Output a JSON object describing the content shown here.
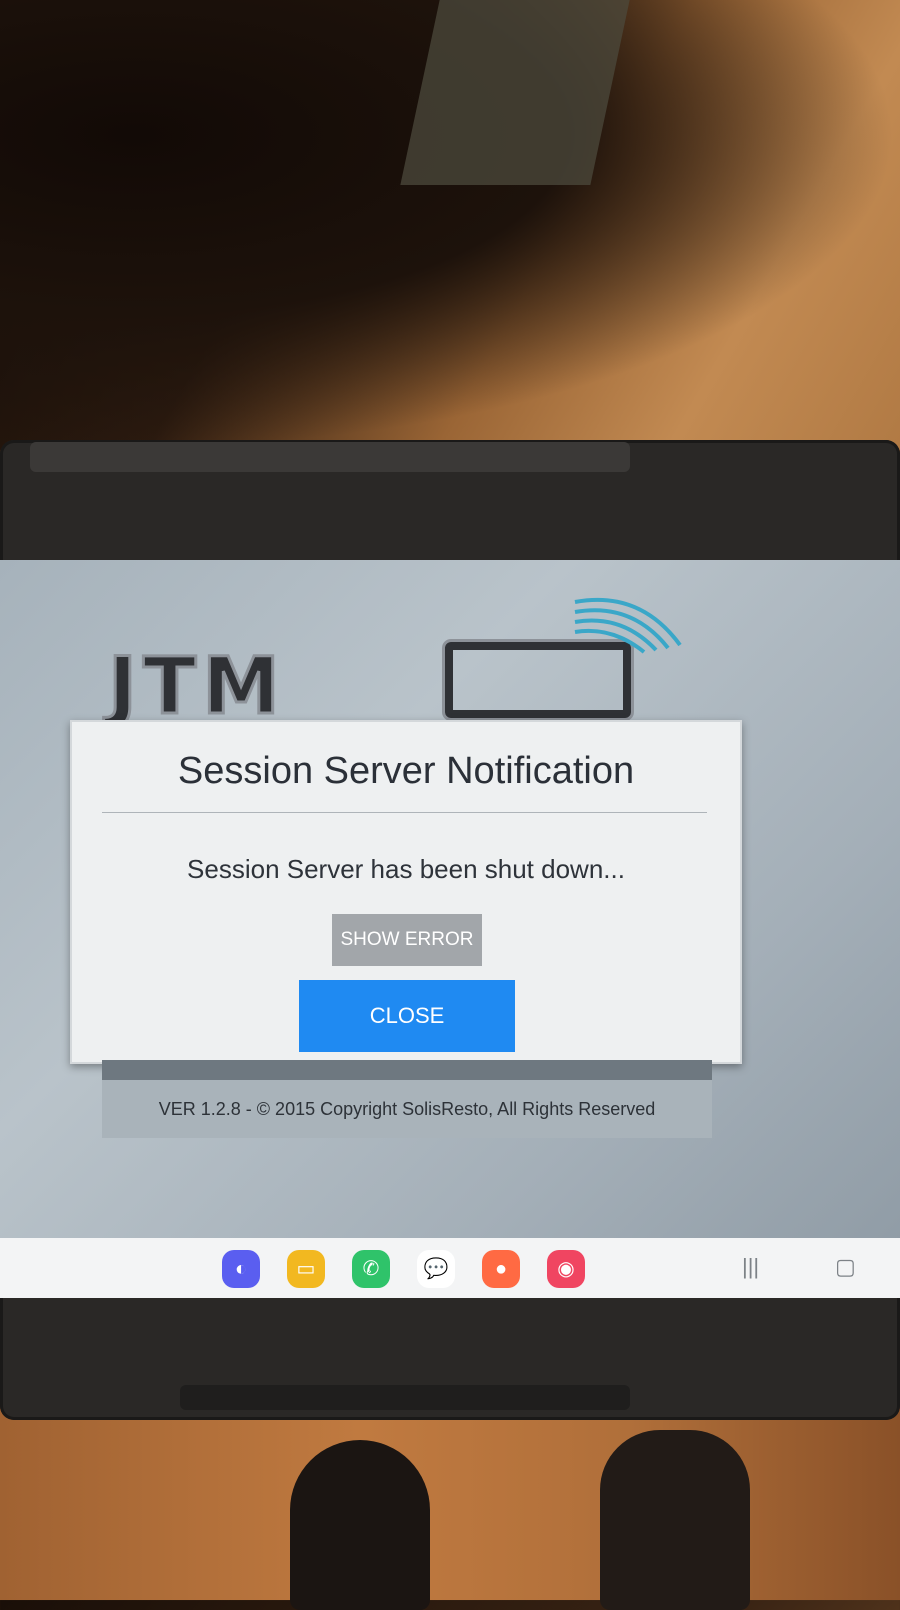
{
  "dialog": {
    "title": "Session Server Notification",
    "message": "Session Server has been shut down...",
    "show_error_label": "SHOW ERROR",
    "close_label": "CLOSE"
  },
  "logo": {
    "text": "JTM"
  },
  "footer": {
    "version_text": "VER 1.2.8  -  © 2015 Copyright SolisResto, All Rights Reserved"
  },
  "taskbar": {
    "apps": [
      {
        "name": "internet",
        "icon": "globe-icon",
        "color": "#5a5ef0",
        "glyph": "◐"
      },
      {
        "name": "files",
        "icon": "folder-icon",
        "color": "#f2b820",
        "glyph": "▭"
      },
      {
        "name": "phone",
        "icon": "phone-icon",
        "color": "#2fc36a",
        "glyph": "✆"
      },
      {
        "name": "messages",
        "icon": "chat-icon",
        "color": "#ffffff",
        "glyph": "💬"
      },
      {
        "name": "contacts",
        "icon": "contact-icon",
        "color": "#ff6a43",
        "glyph": "●"
      },
      {
        "name": "camera",
        "icon": "camera-icon",
        "color": "#f04561",
        "glyph": "◉"
      }
    ],
    "nav": {
      "recents_glyph": "|||",
      "home_glyph": "▢"
    }
  },
  "colors": {
    "accent": "#1f8af2",
    "secondary_button": "#a2a6aa"
  }
}
